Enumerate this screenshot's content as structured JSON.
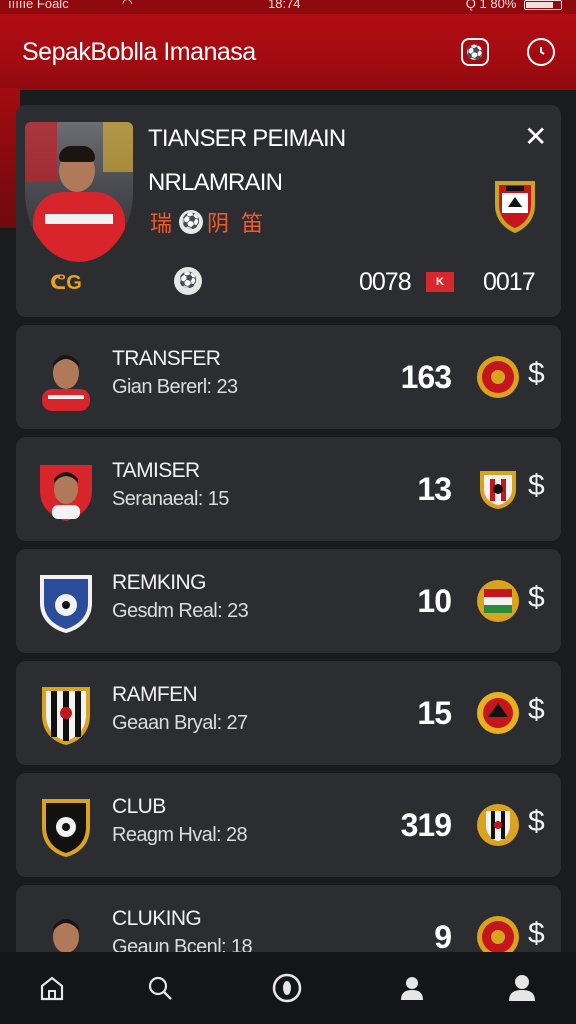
{
  "status_bar": {
    "left": "ıııııe Foalc",
    "clock": "18:74",
    "right": "Ǫ 1 80%",
    "battery_level": 0.8
  },
  "header": {
    "title": "SepakBoblla Imanasa"
  },
  "featured": {
    "title_line1": "TIANSER PEIMAIN",
    "title_line2": "NRLAMRAIN",
    "subtitle_left": "瑞",
    "subtitle_right": "阴 笛",
    "bottom_left": "ᕦG",
    "score_left": "0078",
    "flag_label": "K",
    "score_right": "0017"
  },
  "rows": [
    {
      "name": "TRANSFER",
      "sub": "Gian Bererl: 23",
      "value": "163",
      "avatar": "player-1"
    },
    {
      "name": "TAMISER",
      "sub": "Seranaeal: 15",
      "value": "13",
      "avatar": "club-red"
    },
    {
      "name": "REMKING",
      "sub": "Gesdm Real: 23",
      "value": "10",
      "avatar": "club-blue"
    },
    {
      "name": "RAMFEN",
      "sub": "Geaan Bryal: 27",
      "value": "15",
      "avatar": "club-stripes"
    },
    {
      "name": "CLUB",
      "sub": "Reagm Hval: 28",
      "value": "319",
      "avatar": "club-black"
    },
    {
      "name": "CLUKING",
      "sub": "Geaun Bcenl: 18",
      "value": "9",
      "avatar": "player-2"
    }
  ],
  "currency_symbol": "$",
  "colors": {
    "brand": "#a30b11",
    "card": "#2c2d30",
    "background": "#1a1b1d",
    "accent_orange": "#f15a2a"
  },
  "nav": {
    "items": [
      "home-icon",
      "search-icon",
      "ball-icon",
      "profile-icon",
      "account-icon"
    ]
  }
}
